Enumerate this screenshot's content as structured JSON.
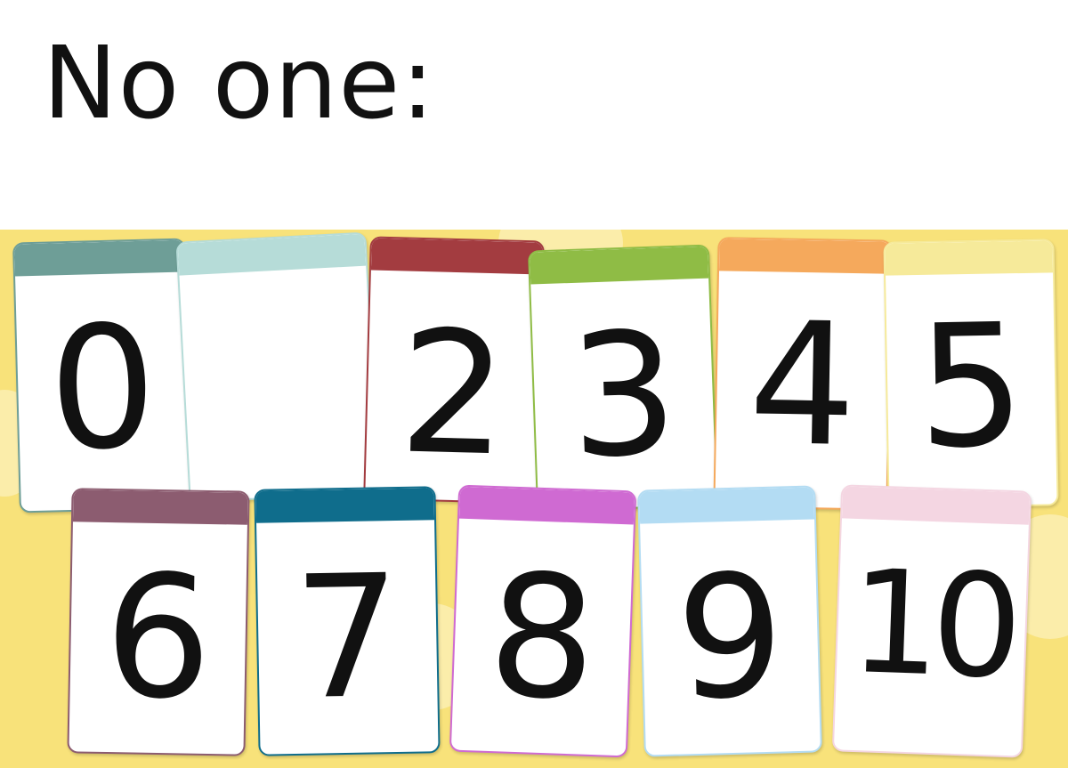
{
  "caption": "No one:",
  "cards": [
    {
      "digit": "0",
      "color": "#6e9e97"
    },
    {
      "digit": "",
      "color": "#b6dcd8"
    },
    {
      "digit": "2",
      "color": "#a33c40"
    },
    {
      "digit": "3",
      "color": "#8fbc45"
    },
    {
      "digit": "4",
      "color": "#f5a95c"
    },
    {
      "digit": "5",
      "color": "#f6ea9a"
    },
    {
      "digit": "6",
      "color": "#8c5c70"
    },
    {
      "digit": "7",
      "color": "#0f6d8c"
    },
    {
      "digit": "8",
      "color": "#cf6ad2"
    },
    {
      "digit": "9",
      "color": "#b3dcf3"
    },
    {
      "digit": "10",
      "color": "#f4d6e2"
    }
  ],
  "background_color": "#f8e27a"
}
